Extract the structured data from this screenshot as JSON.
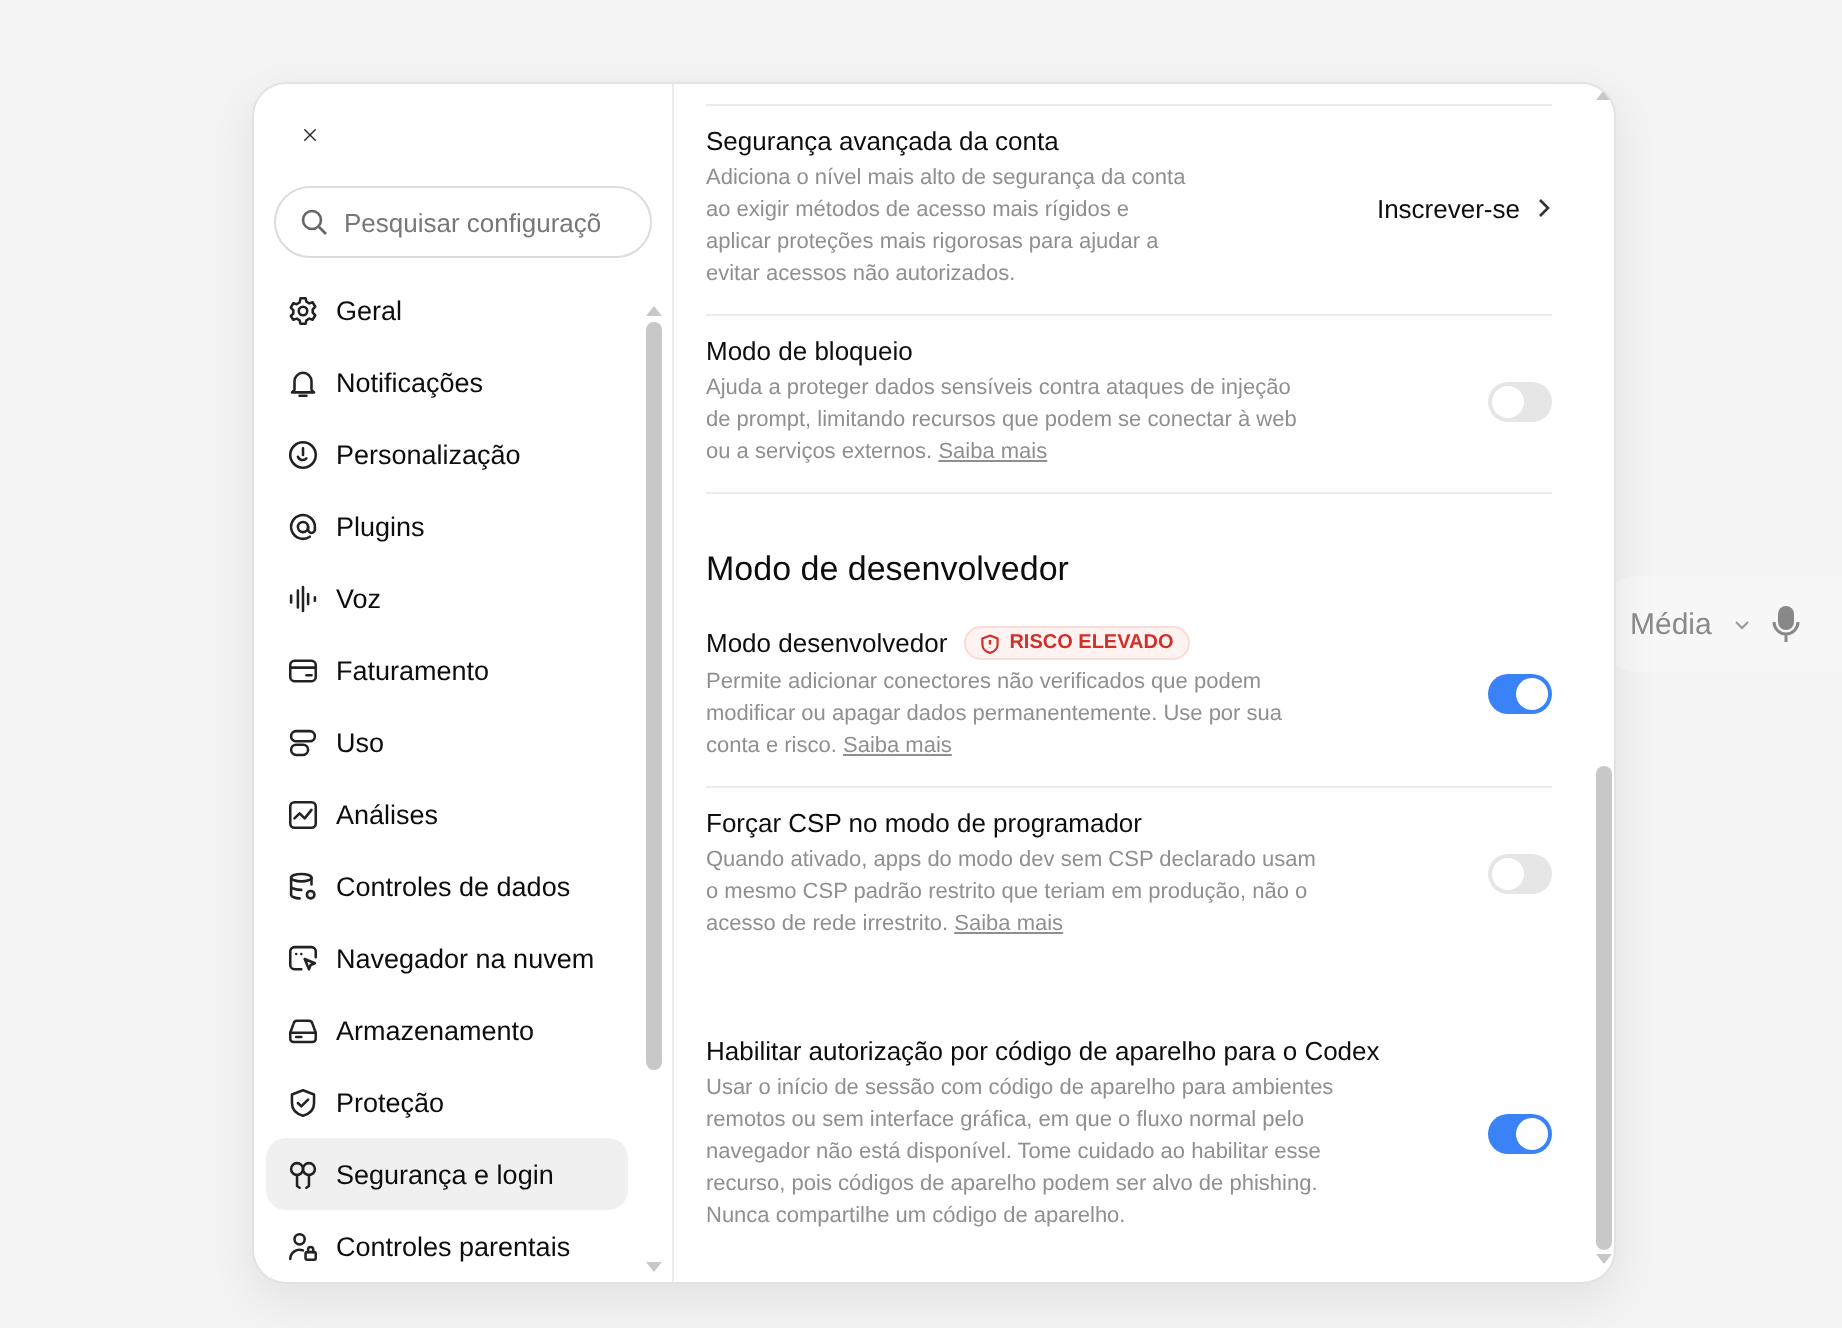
{
  "background": {
    "model_menu": "Média"
  },
  "sidebar": {
    "search": {
      "placeholder": "Pesquisar configuraçõ"
    },
    "items": [
      {
        "label": "Geral",
        "selected": false
      },
      {
        "label": "Notificações",
        "selected": false
      },
      {
        "label": "Personalização",
        "selected": false
      },
      {
        "label": "Plugins",
        "selected": false
      },
      {
        "label": "Voz",
        "selected": false
      },
      {
        "label": "Faturamento",
        "selected": false
      },
      {
        "label": "Uso",
        "selected": false
      },
      {
        "label": "Análises",
        "selected": false
      },
      {
        "label": "Controles de dados",
        "selected": false
      },
      {
        "label": "Navegador na nuvem",
        "selected": false
      },
      {
        "label": "Armazenamento",
        "selected": false
      },
      {
        "label": "Proteção",
        "selected": false
      },
      {
        "label": "Segurança e login",
        "selected": true
      },
      {
        "label": "Controles parentais",
        "selected": false
      }
    ]
  },
  "settings": [
    {
      "kind": "action",
      "title": "Segurança avançada da conta",
      "description": "Adiciona o nível mais alto de segurança da conta ao exigir métodos de acesso mais rígidos e aplicar proteções mais rigorosas para ajudar a evitar acessos não autorizados.",
      "action": "Inscrever-se"
    },
    {
      "kind": "toggle",
      "title": "Modo de bloqueio",
      "description": "Ajuda a proteger dados sensíveis contra ataques de injeção de prompt, limitando recursos que podem se conectar à web ou a serviços externos.",
      "link": "Saiba mais",
      "on": false
    },
    {
      "kind": "heading",
      "title": "Modo de desenvolvedor"
    },
    {
      "kind": "toggle",
      "title": "Modo desenvolvedor",
      "badge": "RISCO ELEVADO",
      "description": "Permite adicionar conectores não verificados que podem modificar ou apagar dados permanentemente. Use por sua conta e risco.",
      "link": "Saiba mais",
      "on": true
    },
    {
      "kind": "toggle",
      "title": "Forçar CSP no modo de programador",
      "description": "Quando ativado, apps do modo dev sem CSP declarado usam o mesmo CSP padrão restrito que teriam em produção, não o acesso de rede irrestrito.",
      "link": "Saiba mais",
      "on": false
    },
    {
      "kind": "toggle",
      "title": "Habilitar autorização por código de aparelho para o Codex",
      "description": "Usar o início de sessão com código de aparelho para ambientes remotos ou sem interface gráfica, em que o fluxo normal pelo navegador não está disponível. Tome cuidado ao habilitar esse recurso, pois códigos de aparelho podem ser alvo de phishing. Nunca compartilhe um código de aparelho.",
      "on": true
    }
  ]
}
